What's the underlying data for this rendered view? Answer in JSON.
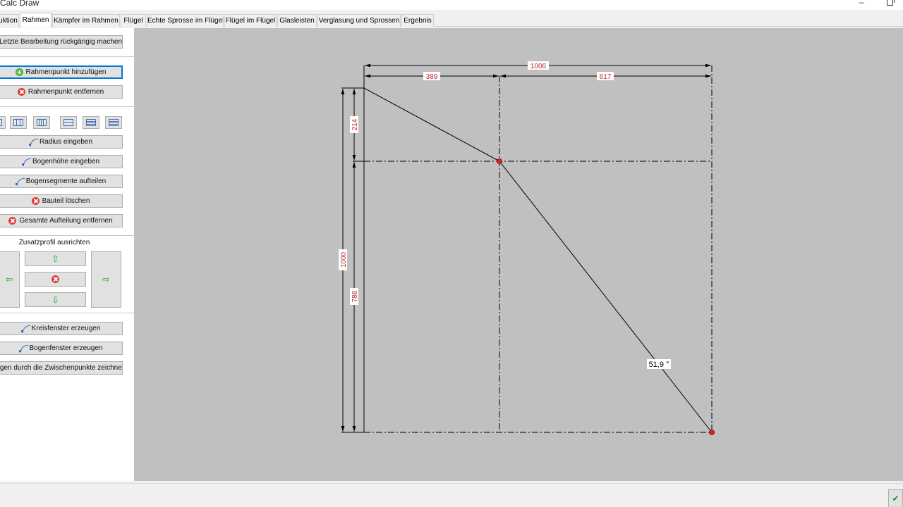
{
  "window": {
    "title": "Calc Draw",
    "minimize_glyph": "–"
  },
  "tabs": [
    {
      "label": "Konstruktion",
      "shown": "uktion"
    },
    {
      "label": "Rahmen",
      "shown": "Rahmen",
      "active": true
    },
    {
      "label": "Kämpfer im Rahmen",
      "shown": "Kämpfer im Rahmen"
    },
    {
      "label": "Flügel",
      "shown": "Flügel"
    },
    {
      "label": "Echte Sprosse im Flügel",
      "shown": "Echte Sprosse im Flügel"
    },
    {
      "label": "Flügel im Flügel",
      "shown": "Flügel im Flügel"
    },
    {
      "label": "Glasleisten",
      "shown": "Glasleisten"
    },
    {
      "label": "Verglasung und Sprossen",
      "shown": "Verglasung und Sprossen"
    },
    {
      "label": "Ergebnis",
      "shown": "Ergebnis"
    }
  ],
  "sidebar": {
    "undo": "Letzte Bearbeitung rückgängig machen",
    "add_point": "Rahmenpunkt hinzufügen",
    "remove_point": "Rahmenpunkt entfernen",
    "radius": "Radius eingeben",
    "arc_height": "Bogenhöhe eingeben",
    "split_arc": "Bogensegmente aufteilen",
    "delete_part": "Bauteil löschen",
    "remove_division": "Gesamte Aufteilung entfernen",
    "align_label": "Zusatzprofil ausrichten",
    "align_up": "⇧",
    "align_down": "⇩",
    "align_left": "⇦",
    "align_right": "⇨",
    "circle_window": "Kreisfenster erzeugen",
    "arch_window": "Bogenfenster erzeugen",
    "draw_arc": "Bogen durch die Zwischenpunkte zeichnen",
    "draw_arc_shown": "Bogen durch die Zwischenpunkte zeichnen"
  },
  "drawing": {
    "dim_total_width": "1006",
    "dim_left_width": "389",
    "dim_right_width": "617",
    "dim_total_height": "1000",
    "dim_top_height": "214",
    "dim_bottom_height": "786",
    "angle": "51,9 °",
    "colors": {
      "dim_text": "#c0282d",
      "line": "#000000",
      "point": "#e02020"
    }
  },
  "statusbar": {
    "ok_glyph": "✔"
  }
}
